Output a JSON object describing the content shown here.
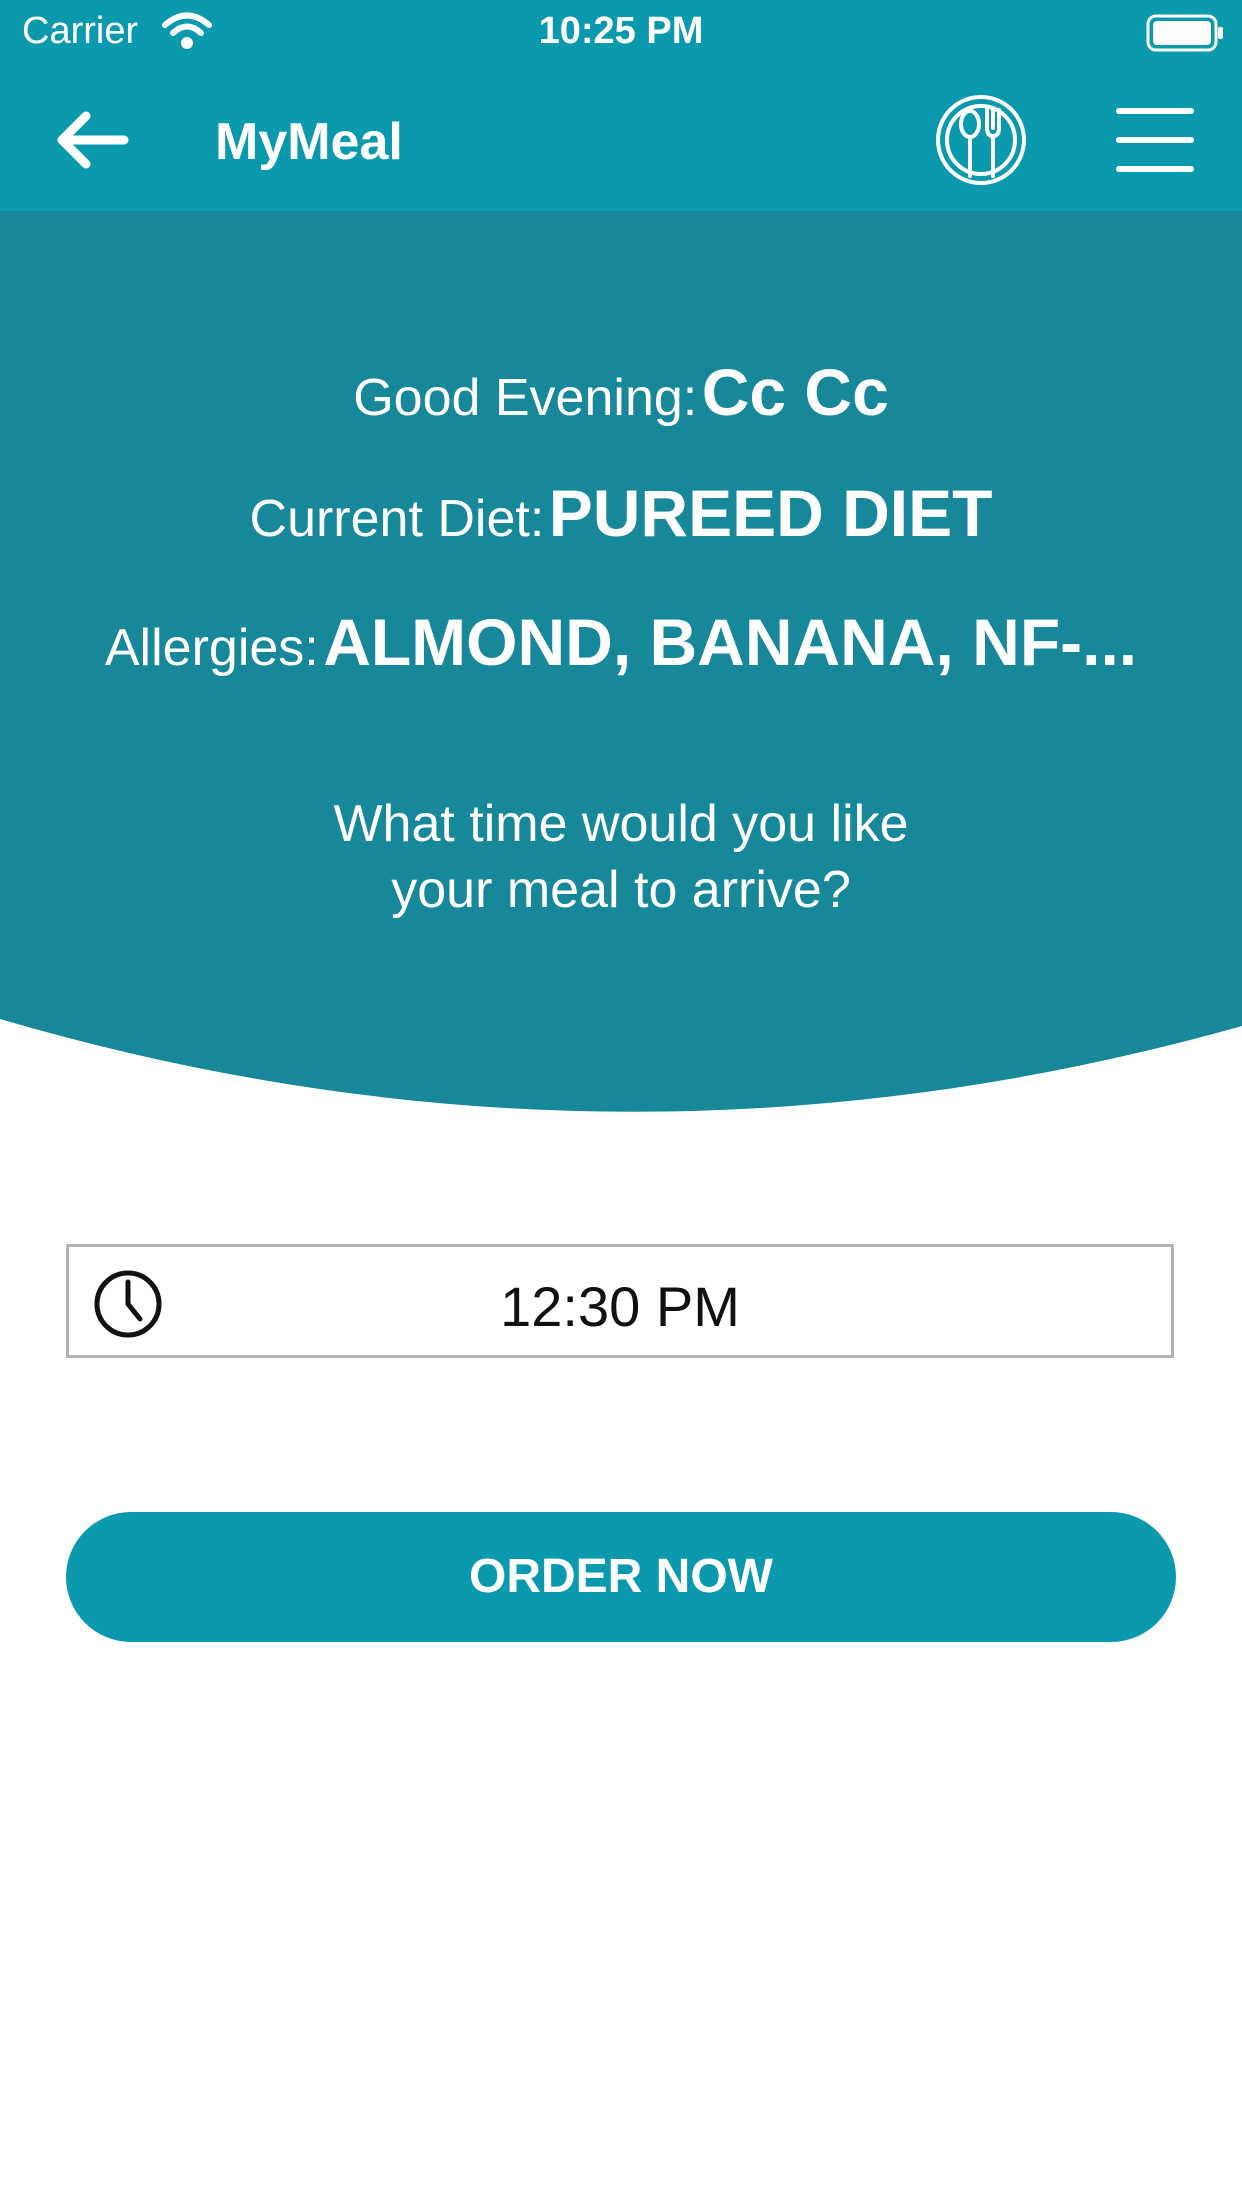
{
  "status_bar": {
    "carrier": "Carrier",
    "time": "10:25 PM"
  },
  "nav": {
    "title": "MyMeal"
  },
  "hero": {
    "greeting_label": "Good Evening:",
    "greeting_name": "Cc Cc",
    "diet_label": "Current Diet:",
    "diet_value": "PUREED DIET",
    "allergies_label": "Allergies:",
    "allergies_value": "ALMOND, BANANA, NF-...",
    "question_line1": "What time would you like",
    "question_line2": "your meal to arrive?"
  },
  "time_field": {
    "value": "12:30 PM"
  },
  "order_button": {
    "label": "ORDER NOW"
  },
  "colors": {
    "header": "#0b99ae",
    "hero": "#17879a",
    "button": "#0b99ae"
  },
  "icons": [
    "wifi-icon",
    "battery-icon",
    "back-arrow-icon",
    "plate-cutlery-icon",
    "hamburger-menu-icon",
    "clock-icon"
  ]
}
